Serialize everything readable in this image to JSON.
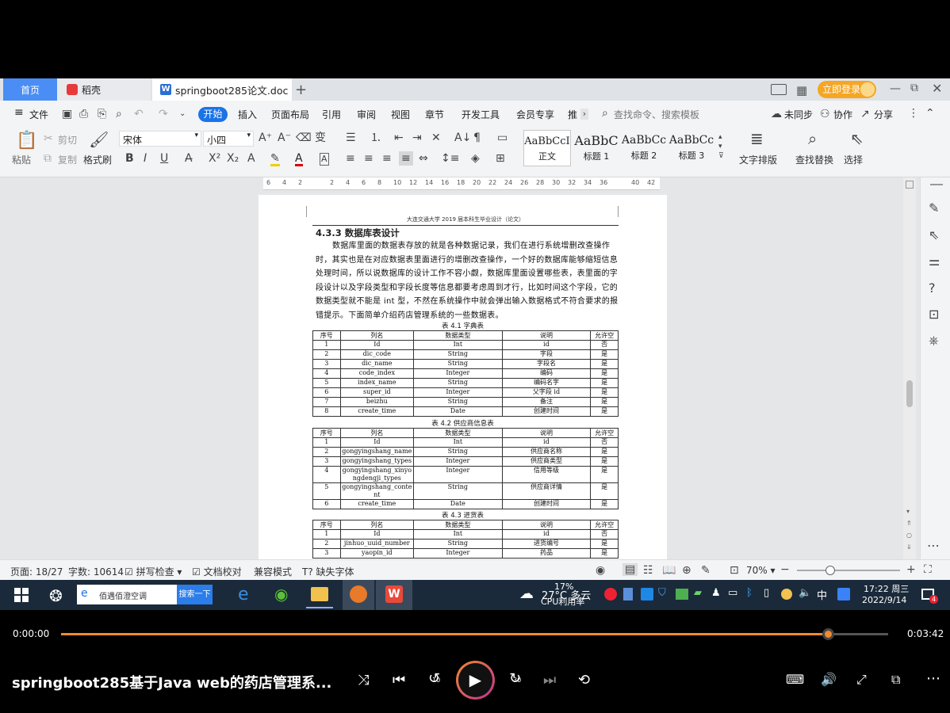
{
  "tabs": {
    "home": "首页",
    "daoke": "稻壳",
    "doc": "springboot285论文.doc",
    "add": "+",
    "login": "立即登录"
  },
  "menu": {
    "file": "文件",
    "items": [
      "开始",
      "插入",
      "页面布局",
      "引用",
      "审阅",
      "视图",
      "章节",
      "开发工具",
      "会员专享",
      "推"
    ],
    "search_placeholder": "查找命令、搜索模板",
    "unsync": "未同步",
    "collab": "协作",
    "share": "分享"
  },
  "toolbar": {
    "paste": "粘贴",
    "cut": "剪切",
    "copy": "复制",
    "format_painter": "格式刷",
    "font_name": "宋体",
    "font_size": "小四",
    "styles": [
      {
        "preview": "AaBbCcI",
        "name": "正文"
      },
      {
        "preview": "AaBbC",
        "name": "标题 1"
      },
      {
        "preview": "AaBbCc",
        "name": "标题 2"
      },
      {
        "preview": "AaBbCc",
        "name": "标题 3"
      }
    ],
    "text_layout": "文字排版",
    "find_replace": "查找替换",
    "select": "选择"
  },
  "ruler": {
    "ticks": [
      "6",
      "4",
      "2",
      "",
      "2",
      "4",
      "6",
      "8",
      "10",
      "12",
      "14",
      "16",
      "18",
      "20",
      "22",
      "24",
      "26",
      "28",
      "30",
      "32",
      "34",
      "36",
      "",
      "40",
      "42"
    ]
  },
  "document": {
    "header": "大连交通大学 2019 届本科生毕业设计（论文）",
    "section_title": "4.3.3  数据库表设计",
    "para_lines": [
      "数据库里面的数据表存放的就是各种数据记录，我们在进行系统增删改查操作",
      "时，其实也是在对应数据表里面进行的增删改查操作，一个好的数据库能够缩短信息",
      "处理时间，所以说数据库的设计工作不容小觑，数据库里面设置哪些表，表里面的字",
      "段设计以及字段类型和字段长度等信息都要考虑周到才行，比如时间这个字段，它的",
      "数据类型就不能是 int 型，不然在系统操作中就会弹出输入数据格式不符合要求的报",
      "错提示。下面简单介绍药店管理系统的一些数据表。"
    ],
    "table_headers": [
      "序号",
      "列名",
      "数据类型",
      "说明",
      "允许空"
    ],
    "table1_caption": "表 4.1 字典表",
    "table1_rows": [
      [
        "1",
        "Id",
        "Int",
        "id",
        "否"
      ],
      [
        "2",
        "dic_code",
        "String",
        "字段",
        "是"
      ],
      [
        "3",
        "dic_name",
        "String",
        "字段名",
        "是"
      ],
      [
        "4",
        "code_index",
        "Integer",
        "编码",
        "是"
      ],
      [
        "5",
        "index_name",
        "String",
        "编码名字",
        "是"
      ],
      [
        "6",
        "super_id",
        "Integer",
        "父字段 id",
        "是"
      ],
      [
        "7",
        "beizhu",
        "String",
        "备注",
        "是"
      ],
      [
        "8",
        "create_time",
        "Date",
        "创建时间",
        "是"
      ]
    ],
    "table2_caption": "表 4.2 供应商信息表",
    "table2_rows": [
      [
        "1",
        "Id",
        "Int",
        "id",
        "否"
      ],
      [
        "2",
        "gongyingshang_name",
        "String",
        "供应商名称",
        "是"
      ],
      [
        "3",
        "gongyingshang_types",
        "Integer",
        "供应商类型",
        "是"
      ],
      [
        "4",
        "gongyingshang_xinyongdengji_types",
        "Integer",
        "信用等级",
        "是"
      ],
      [
        "5",
        "gongyingshang_content",
        "String",
        "供应商详情",
        "是"
      ],
      [
        "6",
        "create_time",
        "Date",
        "创建时间",
        "是"
      ]
    ],
    "table3_caption": "表 4.3 进货表",
    "table3_rows": [
      [
        "1",
        "Id",
        "Int",
        "id",
        "否"
      ],
      [
        "2",
        "jinhuo_uuid_number",
        "String",
        "进货编号",
        "是"
      ],
      [
        "3",
        "yaopin_id",
        "Integer",
        "药品",
        "是"
      ]
    ]
  },
  "status": {
    "page": "页面: 18/27",
    "words": "字数: 10614",
    "spell": "拼写检查",
    "proof": "文档校对",
    "compat": "兼容模式",
    "missing_font": "缺失字体",
    "zoom": "70%"
  },
  "taskbar": {
    "search_text": "佰遇佰澄空调",
    "search_btn": "搜索一下",
    "weather_temp": "27°C 多云",
    "cpu_pct": "17%",
    "cpu_label": "CPU利用率",
    "ime": "中",
    "time": "17:22 周三",
    "date": "2022/9/14",
    "notif_count": "4"
  },
  "player": {
    "current_time": "0:00:00",
    "total_time": "0:03:42",
    "progress": 0.927,
    "title": "springboot285基于Java web的药店管理系...",
    "skip_back": "10",
    "skip_fwd": "30"
  },
  "colors": {
    "accent_blue": "#1a73e8",
    "tab_home": "#4a8ef5",
    "login_orange": "#f5a623",
    "progress": "#f08a30",
    "start_menu": "#2b7de9"
  }
}
